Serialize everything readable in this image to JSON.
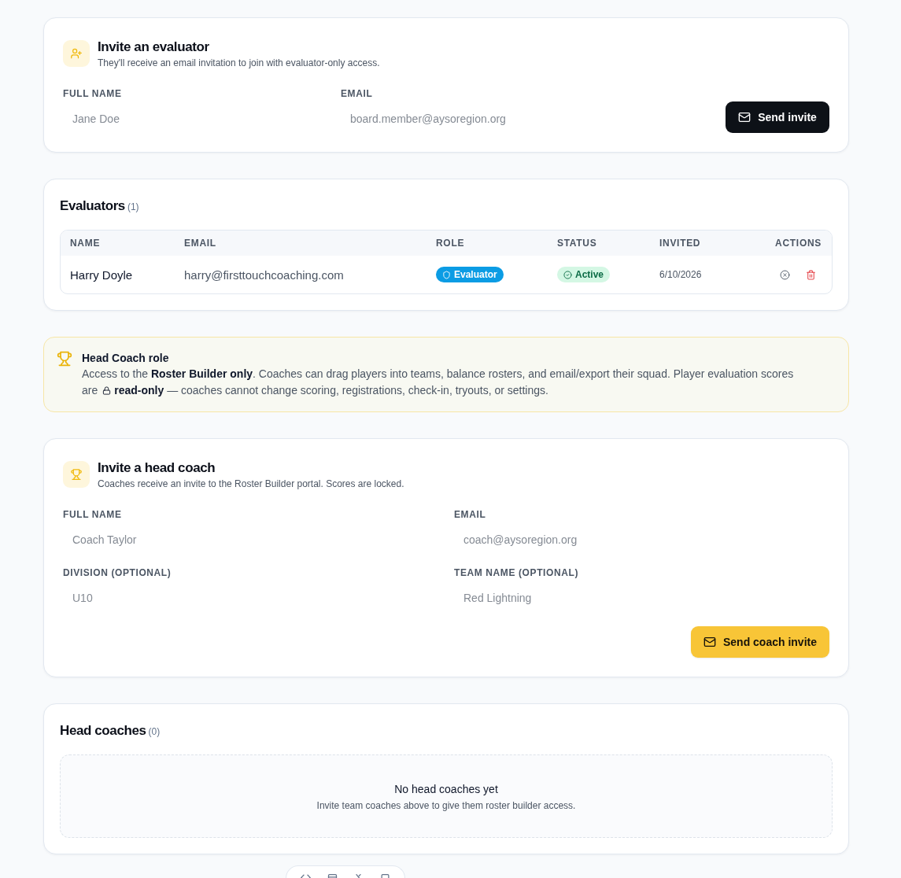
{
  "invite_evaluator": {
    "title": "Invite an evaluator",
    "subtitle": "They'll receive an email invitation to join with evaluator-only access.",
    "fields": [
      {
        "label": "FULL NAME",
        "placeholder": "Jane Doe"
      },
      {
        "label": "EMAIL",
        "placeholder": "board.member@aysoregion.org"
      }
    ],
    "button": "Send invite"
  },
  "evaluators": {
    "title": "Evaluators",
    "count": "(1)",
    "columns": [
      "NAME",
      "EMAIL",
      "ROLE",
      "STATUS",
      "INVITED",
      "ACTIONS"
    ],
    "rows": [
      {
        "name": "Harry Doyle",
        "email": "harry@firsttouchcoaching.com",
        "role": "Evaluator",
        "status": "Active",
        "invited": "6/10/2026"
      }
    ]
  },
  "head_coach_role": {
    "title": "Head Coach role",
    "description": "Access to the **Roster Builder only**. Coaches can drag players into teams, balance rosters, and email/export their squad. Player evaluation scores",
    "lock_prefix": "are",
    "lock_text": "**read-only** — coaches cannot change scoring, registrations, check-in, tryouts, or settings."
  },
  "invite_head_coach": {
    "title": "Invite a head coach",
    "subtitle": "Coaches receive an invite to the Roster Builder portal. Scores are locked.",
    "fields": [
      {
        "label": "FULL NAME",
        "placeholder": "Coach Taylor"
      },
      {
        "label": "EMAIL",
        "placeholder": "coach@aysoregion.org"
      },
      {
        "label": "DIVISION (OPTIONAL)",
        "placeholder": "U10"
      },
      {
        "label": "TEAM NAME (OPTIONAL)",
        "placeholder": "Red Lightning"
      }
    ],
    "button": "Send coach invite"
  },
  "head_coaches": {
    "title": "Head coaches",
    "count": "(0)",
    "empty_title": "No head coaches yet",
    "empty_text": "Invite team coaches above to give them roster builder access."
  }
}
